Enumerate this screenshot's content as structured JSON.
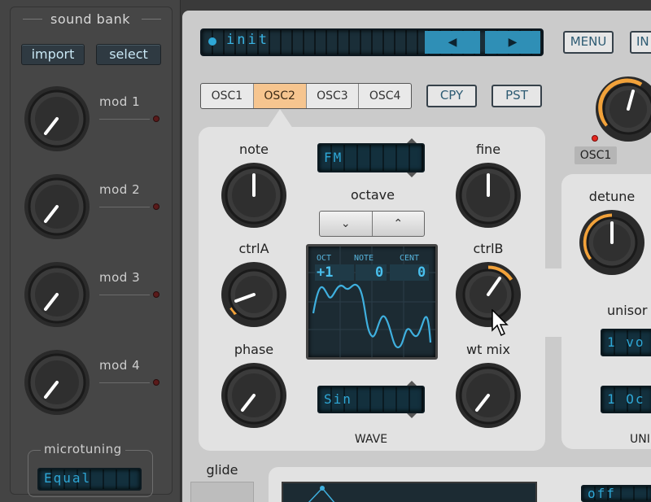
{
  "sidebar": {
    "sound_bank_title": "sound bank",
    "import_label": "import",
    "select_label": "select",
    "mods": [
      {
        "label": "mod 1"
      },
      {
        "label": "mod 2"
      },
      {
        "label": "mod 3"
      },
      {
        "label": "mod 4"
      }
    ],
    "microtuning_title": "microtuning",
    "microtuning_value": "Equal"
  },
  "header": {
    "preset_name": "init",
    "prev_icon": "triangle-left-icon",
    "next_icon": "triangle-right-icon",
    "menu_label": "MENU",
    "cut_label": "IN"
  },
  "osc_tabs": [
    "OSC1",
    "OSC2",
    "OSC3",
    "OSC4"
  ],
  "active_tab": "OSC2",
  "copy_label": "CPY",
  "paste_label": "PST",
  "osc": {
    "note_label": "note",
    "fine_label": "fine",
    "octave_label": "octave",
    "octave_down": "⌄",
    "octave_up": "⌃",
    "ctrla_label": "ctrlA",
    "ctrlb_label": "ctrlB",
    "phase_label": "phase",
    "wtmix_label": "wt mix",
    "mode_value": "FM",
    "wave_value": "Sin",
    "wave_title": "WAVE",
    "display": {
      "oct_label": "OCT",
      "note_label": "NOTE",
      "cent_label": "CENT",
      "oct_value": "+1",
      "note_value": "0",
      "cent_value": "0"
    }
  },
  "right": {
    "osc1_label": "OSC1",
    "detune_label": "detune",
    "unison_label": "unisor",
    "voices_value": "1 vo",
    "oct_value": "1 Oc",
    "unison_title": "UNI"
  },
  "glide_label": "glide",
  "off_value": "off",
  "colors": {
    "accent_orange": "#f2a23a",
    "lcd_text": "#2ea7d6",
    "lcd_bg": "#13303d",
    "active_tab": "#f6c58f"
  }
}
